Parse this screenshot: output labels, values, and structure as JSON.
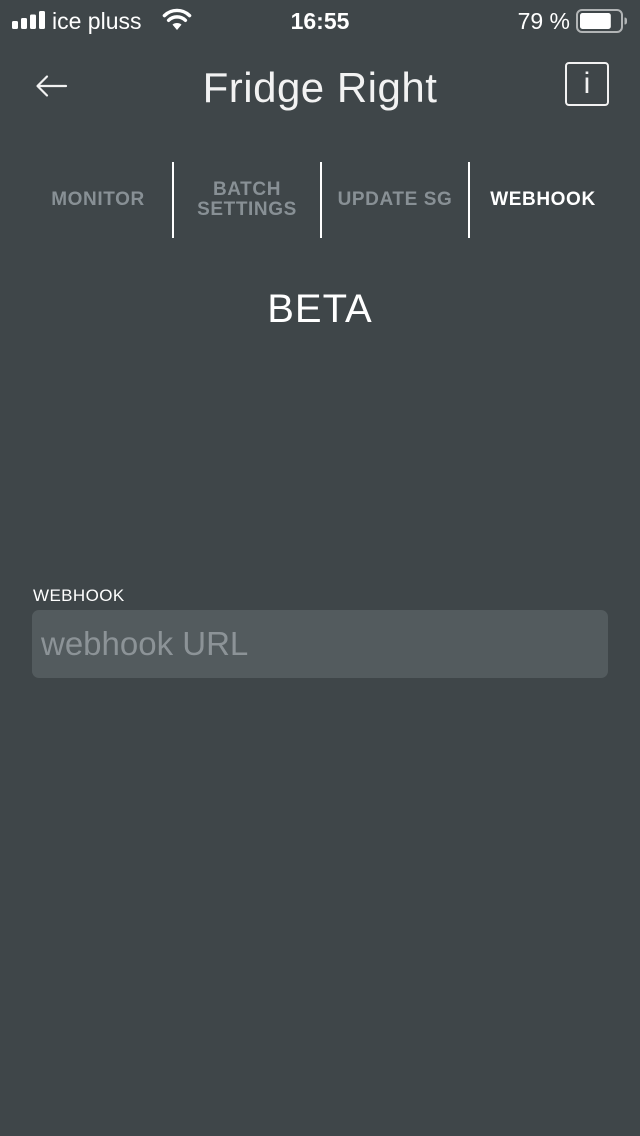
{
  "status_bar": {
    "carrier": "ice pluss",
    "time": "16:55",
    "battery_percent": "79 %",
    "battery_level": 0.79,
    "icons": [
      "signal-icon",
      "wifi-icon",
      "battery-icon"
    ]
  },
  "header": {
    "title": "Fridge Right",
    "back_icon": "arrow-left-icon",
    "info_label": "i"
  },
  "tabs": [
    {
      "label": "MONITOR",
      "active": false
    },
    {
      "label": "BATCH\nSETTINGS",
      "active": false
    },
    {
      "label": "UPDATE SG",
      "active": false
    },
    {
      "label": "WEBHOOK",
      "active": true
    }
  ],
  "content": {
    "beta_label": "BETA",
    "webhook_field": {
      "label": "WEBHOOK",
      "value": "",
      "placeholder": "webhook URL"
    }
  },
  "colors": {
    "background": "#3f4649",
    "input_background": "#535b5e",
    "inactive_tab": "#889095",
    "text": "#ffffff"
  }
}
